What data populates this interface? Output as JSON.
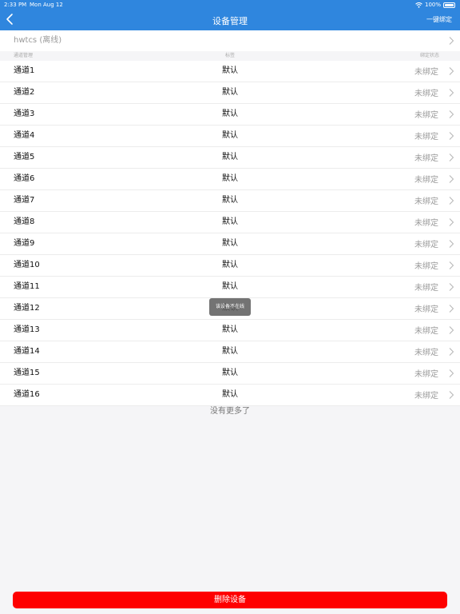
{
  "status_bar": {
    "time": "2:33 PM",
    "date": "Mon Aug 12",
    "battery": "100%"
  },
  "nav": {
    "title": "设备管理",
    "action": "一键绑定"
  },
  "device": {
    "name": "hwtcs (离线)"
  },
  "columns": {
    "channel": "通道管理",
    "tag": "标签",
    "bind_status": "绑定状态"
  },
  "channels": [
    {
      "name": "通道1",
      "tag": "默认",
      "status": "未绑定"
    },
    {
      "name": "通道2",
      "tag": "默认",
      "status": "未绑定"
    },
    {
      "name": "通道3",
      "tag": "默认",
      "status": "未绑定"
    },
    {
      "name": "通道4",
      "tag": "默认",
      "status": "未绑定"
    },
    {
      "name": "通道5",
      "tag": "默认",
      "status": "未绑定"
    },
    {
      "name": "通道6",
      "tag": "默认",
      "status": "未绑定"
    },
    {
      "name": "通道7",
      "tag": "默认",
      "status": "未绑定"
    },
    {
      "name": "通道8",
      "tag": "默认",
      "status": "未绑定"
    },
    {
      "name": "通道9",
      "tag": "默认",
      "status": "未绑定"
    },
    {
      "name": "通道10",
      "tag": "默认",
      "status": "未绑定"
    },
    {
      "name": "通道11",
      "tag": "默认",
      "status": "未绑定"
    },
    {
      "name": "通道12",
      "tag": "默认",
      "status": "未绑定"
    },
    {
      "name": "通道13",
      "tag": "默认",
      "status": "未绑定"
    },
    {
      "name": "通道14",
      "tag": "默认",
      "status": "未绑定"
    },
    {
      "name": "通道15",
      "tag": "默认",
      "status": "未绑定"
    },
    {
      "name": "通道16",
      "tag": "默认",
      "status": "未绑定"
    }
  ],
  "no_more": "没有更多了",
  "toast": "该设备不在线",
  "delete_button": "删除设备",
  "colors": {
    "header": "#2f86de",
    "delete": "#fe0000",
    "background": "#f5f5f7"
  }
}
